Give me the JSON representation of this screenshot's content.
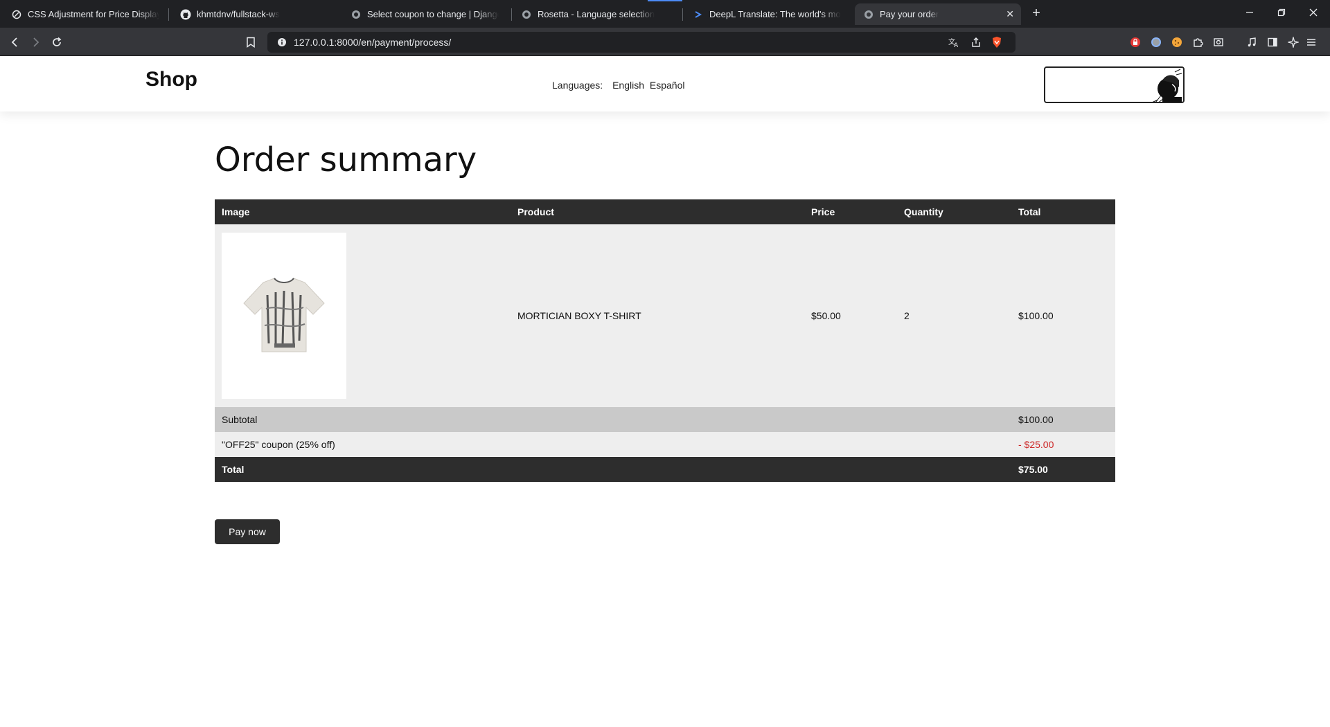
{
  "browser": {
    "tabs": [
      {
        "title": "CSS Adjustment for Price Display - Gr",
        "icon": "openai-icon"
      },
      {
        "title": "khmtdnv/fullstack-ws",
        "icon": "github-icon"
      },
      {
        "title": "Select coupon to change | Django site",
        "icon": "globe-icon"
      },
      {
        "title": "Rosetta - Language selection",
        "icon": "globe-icon"
      },
      {
        "title": "DeepL Translate: The world's most accurate",
        "icon": "deepl-icon"
      },
      {
        "title": "Pay your order",
        "icon": "globe-icon",
        "active": true
      }
    ],
    "new_tab": "+",
    "url": "127.0.0.1:8000/en/payment/process/"
  },
  "header": {
    "logo": "Shop",
    "languages_label": "Languages:",
    "languages": [
      "English",
      "Español"
    ]
  },
  "page": {
    "title": "Order summary",
    "table": {
      "columns": [
        "Image",
        "Product",
        "Price",
        "Quantity",
        "Total"
      ],
      "items": [
        {
          "product": "MORTICIAN BOXY T-SHIRT",
          "price": "$50.00",
          "quantity": "2",
          "total": "$100.00"
        }
      ],
      "subtotal_label": "Subtotal",
      "subtotal_value": "$100.00",
      "coupon_label": "\"OFF25\" coupon (25% off)",
      "coupon_value": "- $25.00",
      "total_label": "Total",
      "total_value": "$75.00"
    },
    "pay_button": "Pay now"
  },
  "colors": {
    "header_dark": "#2d2d2d",
    "discount": "#cc2222",
    "subtotal_row": "#c9c9c9",
    "row_light": "#eeeeee"
  }
}
